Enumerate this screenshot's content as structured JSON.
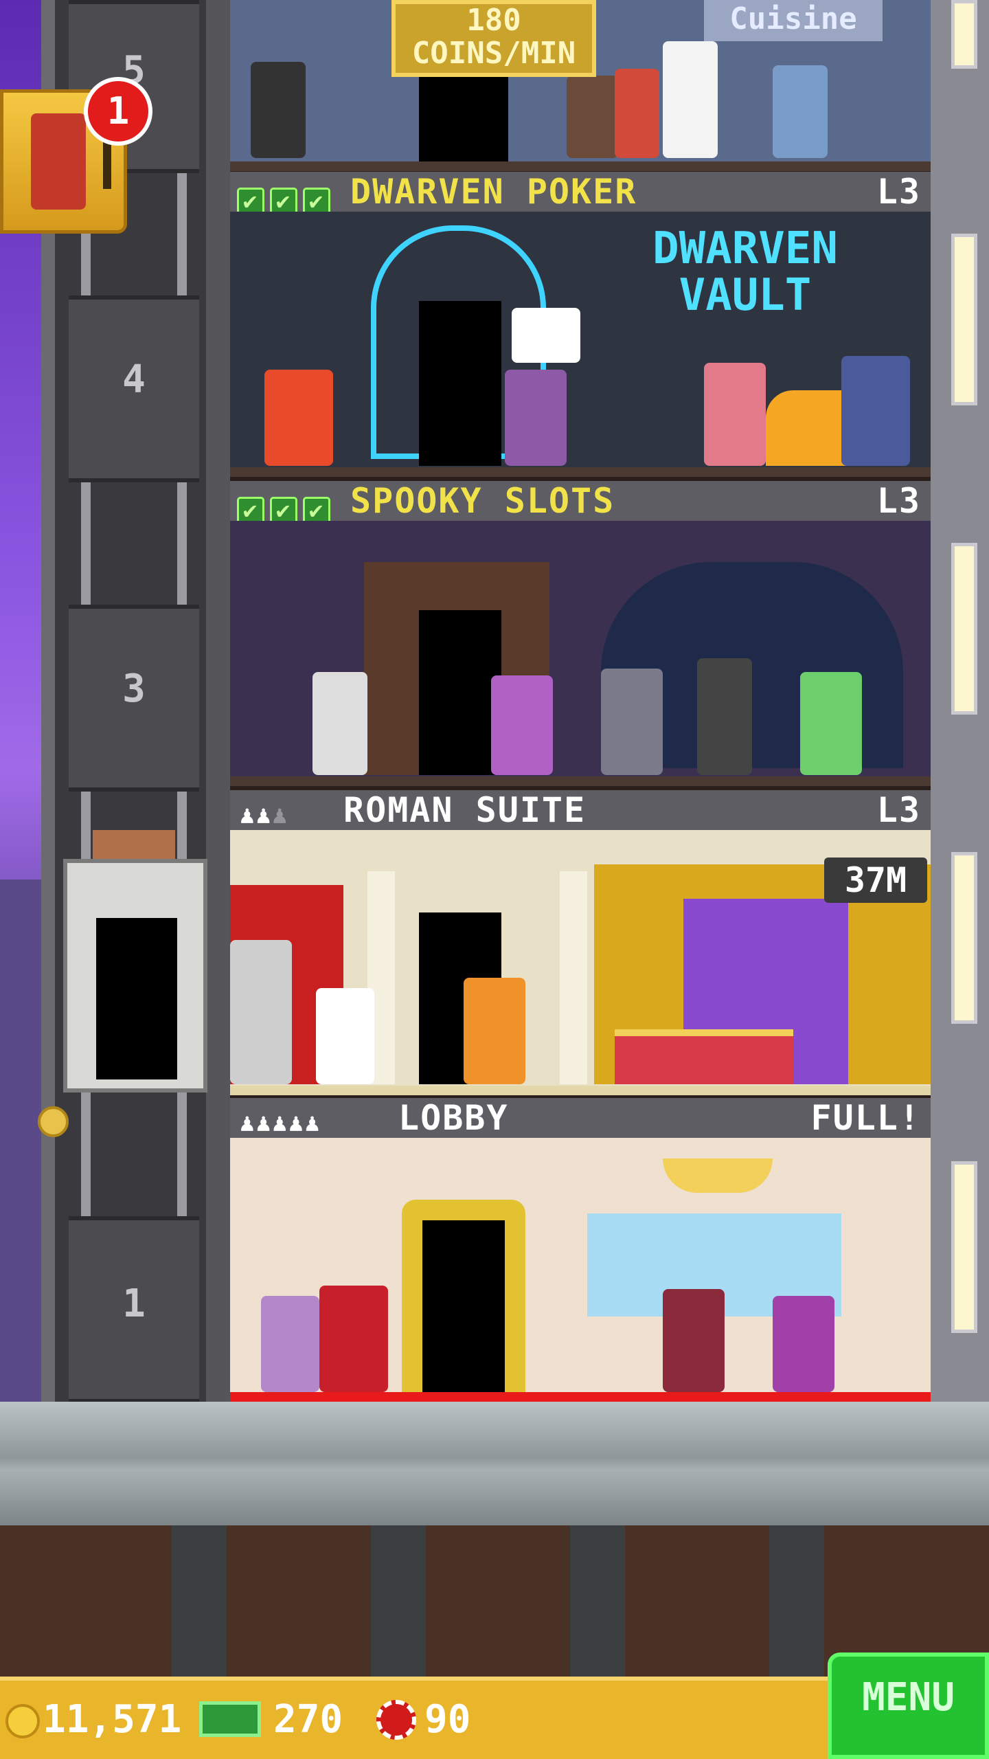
{
  "top_floor": {
    "coins_rate": "180",
    "coins_unit": "COINS/MIN",
    "sign_text": "Cuisine"
  },
  "notification": {
    "badge_count": "1"
  },
  "elevator": {
    "floor_numbers": [
      "5",
      "4",
      "3",
      "1"
    ]
  },
  "floors": [
    {
      "name": "DWARVEN POKER",
      "level": "L3",
      "checks": 3,
      "sign": "DWARVEN VAULT"
    },
    {
      "name": "SPOOKY SLOTS",
      "level": "L3",
      "checks": 3
    },
    {
      "name": "ROMAN SUITE",
      "level": "L3",
      "timer": "37M"
    },
    {
      "name": "LOBBY",
      "level": "FULL!"
    }
  ],
  "check_glyph": "✔",
  "person_glyph": "♟",
  "bottom_bar": {
    "coins": "11,571",
    "bux": "270",
    "chips": "90",
    "menu_label": "MENU"
  },
  "colors": {
    "banner_gold": "#f2e24a",
    "menu_green": "#22c230",
    "bar_gold": "#e9b52a"
  }
}
